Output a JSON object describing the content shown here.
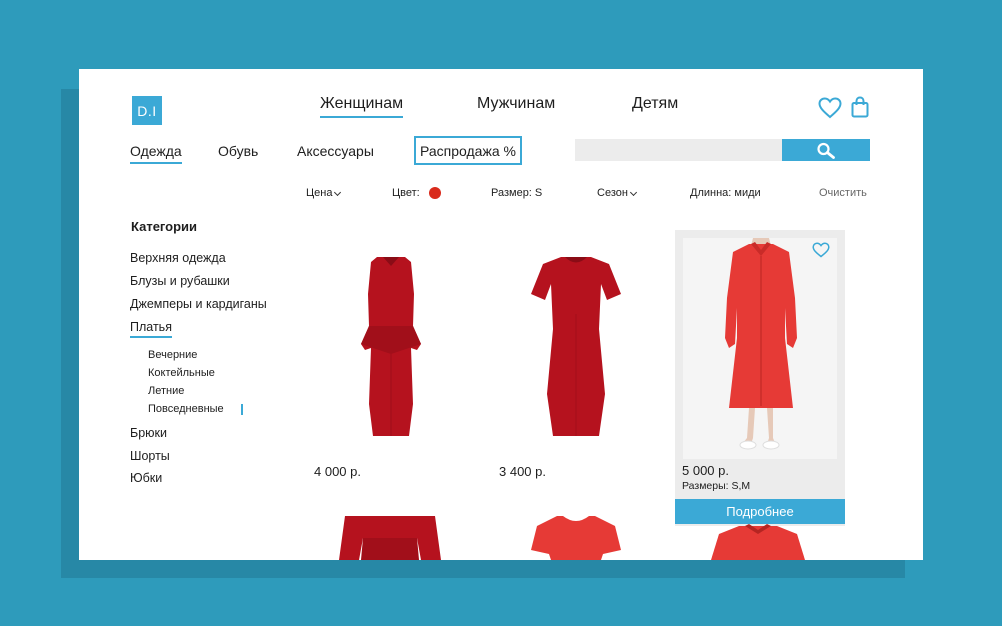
{
  "logo": {
    "text": "D.I"
  },
  "main_nav": [
    {
      "label": "Женщинам",
      "active": true
    },
    {
      "label": "Мужчинам",
      "active": false
    },
    {
      "label": "Детям",
      "active": false
    }
  ],
  "sub_nav": [
    {
      "label": "Одежда",
      "active": true
    },
    {
      "label": "Обувь",
      "active": false
    },
    {
      "label": "Аксессуары",
      "active": false
    },
    {
      "label": "Распродажа %",
      "active": false
    }
  ],
  "search": {
    "value": "",
    "placeholder": ""
  },
  "filters": {
    "price": "Цена",
    "color": "Цвет:",
    "size": "Размер: S",
    "season": "Сезон",
    "length": "Длинна: миди",
    "clear": "Очистить"
  },
  "categories": {
    "title": "Категории",
    "items": [
      {
        "label": "Верхняя одежда"
      },
      {
        "label": "Блузы и рубашки"
      },
      {
        "label": "Джемперы и кардиганы"
      },
      {
        "label": "Платья",
        "active": true
      },
      {
        "label": "Брюки"
      },
      {
        "label": "Шорты"
      },
      {
        "label": "Юбки"
      }
    ],
    "subitems": [
      {
        "label": "Вечерние"
      },
      {
        "label": "Коктейльные"
      },
      {
        "label": "Летние"
      },
      {
        "label": "Повседневные",
        "active": true
      }
    ]
  },
  "products": [
    {
      "price": "4 000 р."
    },
    {
      "price": "3 400 р."
    },
    {
      "price": "5 000 р.",
      "sizes": "Размеры: S,M",
      "button": "Подробнее"
    }
  ],
  "colors": {
    "accent": "#3ba9d6",
    "background": "#2e9bbb",
    "dress": "#b5121e",
    "dress_bright": "#e63a36",
    "filter_dot": "#d92b1c"
  }
}
